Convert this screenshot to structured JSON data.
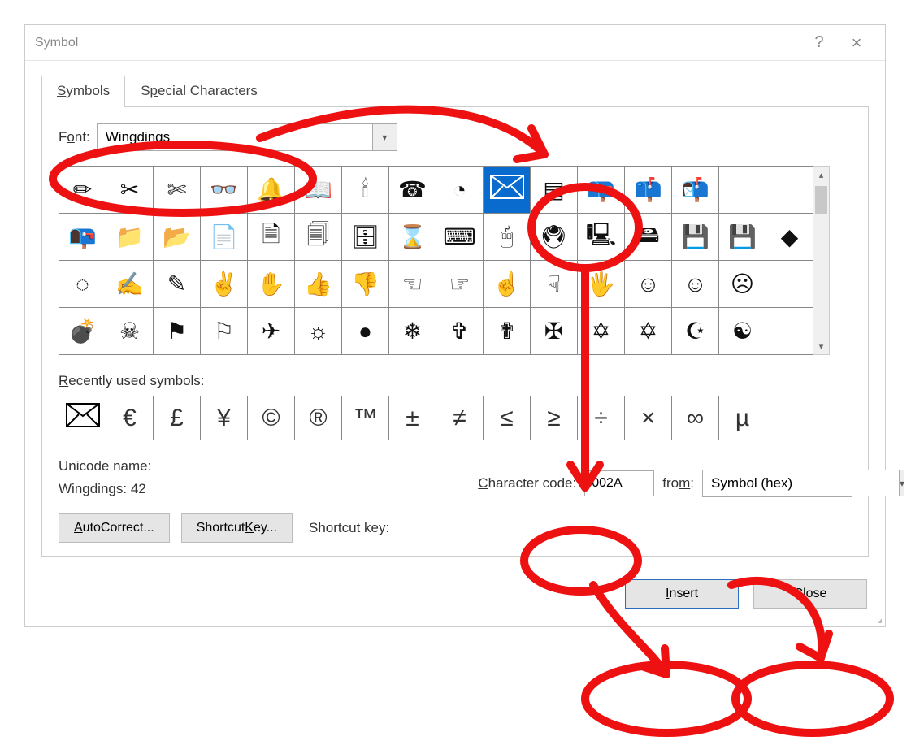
{
  "dialog": {
    "title": "Symbol",
    "help_char": "?",
    "close_char": "×"
  },
  "tabs": [
    {
      "label_pre": "",
      "label_u": "S",
      "label_post": "ymbols",
      "active": true
    },
    {
      "label_pre": "S",
      "label_u": "p",
      "label_post": "ecial Characters",
      "active": false
    }
  ],
  "font_label_pre": "F",
  "font_label_u": "o",
  "font_label_post": "nt:",
  "font_value": "Wingdings",
  "grid_rows": [
    [
      "✏",
      "✂",
      "✄",
      "👓",
      "🔔",
      "📖",
      "🕯",
      "☎",
      "◔",
      "✉",
      "▤",
      "📪",
      "📫",
      "📬"
    ],
    [
      "📭",
      "📁",
      "📂",
      "📄",
      "🗎",
      "🗐",
      "🗄",
      "⌛",
      "⌨",
      "🖰",
      "🖲",
      "🖳",
      "🖴",
      "💾",
      "💾",
      "◆"
    ],
    [
      "◌",
      "✍",
      "✎",
      "✌",
      "✋",
      "👍",
      "👎",
      "☜",
      "☞",
      "☝",
      "☟",
      "🖐",
      "☺",
      "☺",
      "☹",
      ""
    ],
    [
      "💣",
      "☠",
      "⚑",
      "⚐",
      "✈",
      "☼",
      "●",
      "❄",
      "✞",
      "✟",
      "✠",
      "✡",
      "✡",
      "☪",
      "☯",
      ""
    ]
  ],
  "grid_selected": {
    "row": 0,
    "col": 9
  },
  "recent_label_u": "R",
  "recent_label_post": "ecently used symbols:",
  "recent": [
    "✉",
    "€",
    "£",
    "¥",
    "©",
    "®",
    "™",
    "±",
    "≠",
    "≤",
    "≥",
    "÷",
    "×",
    "∞",
    "µ"
  ],
  "unicode_name_label": "Unicode name:",
  "unicode_name_value": "Wingdings: 42",
  "char_code_label_u": "C",
  "char_code_label_post": "haracter code:",
  "char_code_value": "002A",
  "from_label_pre": "fro",
  "from_label_u": "m",
  "from_label_post": ":",
  "from_value": "Symbol (hex)",
  "autocorrect_label_u": "A",
  "autocorrect_label_post": "utoCorrect...",
  "shortcutkey_label_pre": "Shortcut ",
  "shortcutkey_label_u": "K",
  "shortcutkey_label_post": "ey...",
  "shortcut_display_label": "Shortcut key:",
  "insert_label_u": "I",
  "insert_label_post": "nsert",
  "close_label": "Close"
}
